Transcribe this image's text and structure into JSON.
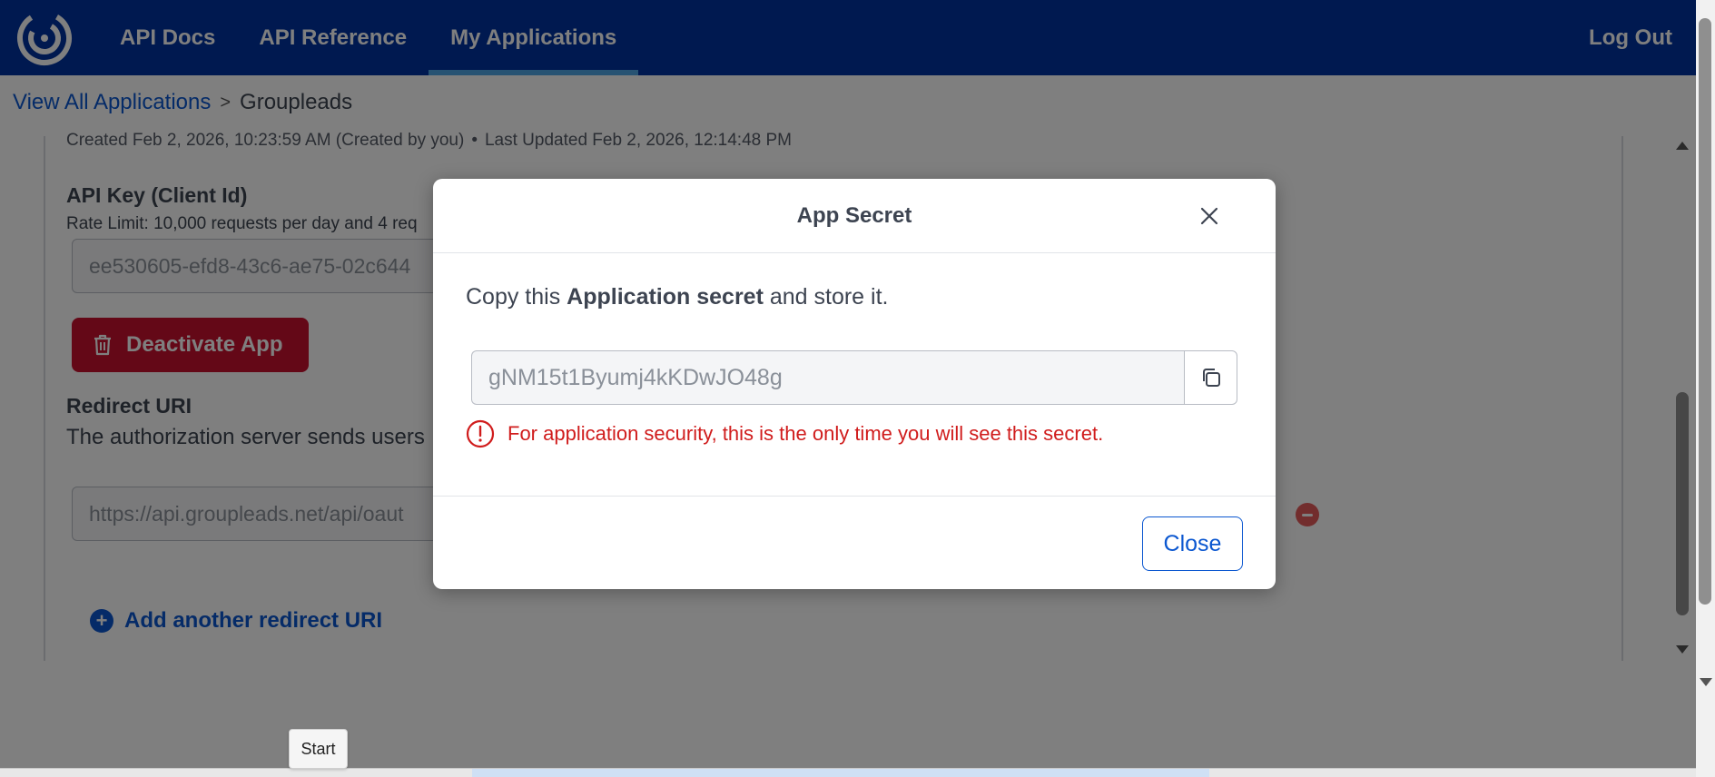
{
  "header": {
    "nav": [
      {
        "label": "API Docs"
      },
      {
        "label": "API Reference"
      },
      {
        "label": "My Applications",
        "active": true
      }
    ],
    "logout_label": "Log Out",
    "bg_color": "#0033a0"
  },
  "breadcrumb": {
    "parent": "View All Applications",
    "separator": ">",
    "current": "Groupleads"
  },
  "app": {
    "created": "Created Feb 2, 2026, 10:23:59 AM (Created by you)",
    "separator": "•",
    "updated": "Last Updated Feb 2, 2026, 12:14:48 PM",
    "api_key_label": "API Key (Client Id)",
    "rate_limit": "Rate Limit: 10,000 requests per day and 4 req",
    "api_key_value": "ee530605-efd8-43c6-ae75-02c644",
    "deactivate_label": "Deactivate App",
    "redirect_label": "Redirect URI",
    "redirect_desc": "The authorization server sends users",
    "redirect_value": "https://api.groupleads.net/api/oaut",
    "add_redirect_label": "Add another redirect URI"
  },
  "modal": {
    "title": "App Secret",
    "instruction_prefix": "Copy this ",
    "instruction_bold": "Application secret",
    "instruction_suffix": " and store it.",
    "secret_value": "gNM15t1Byumj4kKDwJO48g",
    "warning": "For application security, this is the only time you will see this secret.",
    "close_label": "Close"
  },
  "tooltip": {
    "label": "Start"
  },
  "colors": {
    "accent": "#0b57d0",
    "danger": "#c8102e",
    "warning_text": "#d01c1c"
  }
}
